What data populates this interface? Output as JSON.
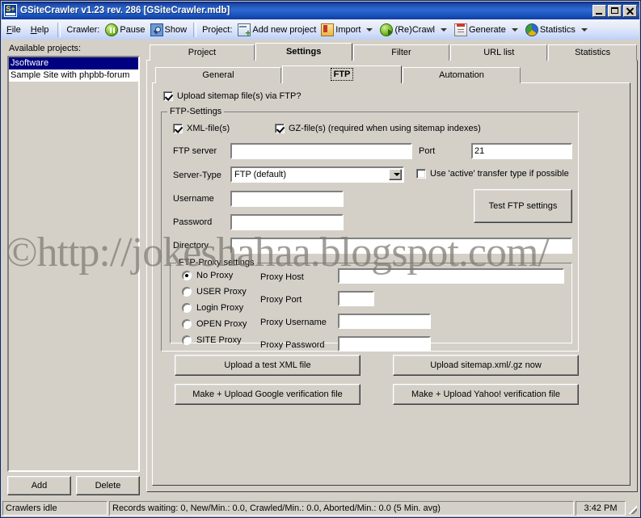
{
  "window": {
    "title": "GSiteCrawler v1.23 rev. 286 [GSiteCrawler.mdb]",
    "icon_label": "S+",
    "buttons": {
      "minimize": "minimize-icon",
      "maximize": "maximize-icon",
      "close": "close-icon"
    }
  },
  "menu": {
    "items": [
      {
        "label": "File",
        "accel": "F"
      },
      {
        "label": "Help",
        "accel": "H"
      }
    ]
  },
  "toolbar": {
    "crawler_label": "Crawler:",
    "pause_label": "Pause",
    "pause_icon": "pause-icon",
    "show_label": "Show",
    "show_icon": "magnifier-icon",
    "project_label": "Project:",
    "add_project_label": "Add new project",
    "add_project_icon": "add-project-icon",
    "import_label": "Import",
    "import_icon": "import-folder-icon",
    "recrawl_label": "(Re)Crawl",
    "recrawl_icon": "crawl-icon",
    "generate_label": "Generate",
    "generate_icon": "generate-icon",
    "statistics_label": "Statistics",
    "statistics_icon": "statistics-pie-icon"
  },
  "sidebar": {
    "title": "Available projects:",
    "projects": [
      {
        "name": "Jsoftware",
        "selected": true
      },
      {
        "name": "Sample Site with phpbb-forum",
        "selected": false
      }
    ],
    "add_button": "Add",
    "delete_button": "Delete"
  },
  "tabs": {
    "main": [
      {
        "label": "Project",
        "active": false
      },
      {
        "label": "Settings",
        "active": true
      },
      {
        "label": "Filter",
        "active": false
      },
      {
        "label": "URL list",
        "active": false
      },
      {
        "label": "Statistics",
        "active": false
      }
    ],
    "sub": [
      {
        "label": "General",
        "active": false
      },
      {
        "label": "FTP",
        "active": true
      },
      {
        "label": "Automation",
        "active": false
      }
    ]
  },
  "ftp": {
    "upload_via_ftp": {
      "label": "Upload sitemap file(s) via FTP?",
      "checked": true
    },
    "settings_group_title": "FTP-Settings",
    "xml_files": {
      "label": "XML-file(s)",
      "checked": true
    },
    "gz_files": {
      "label": "GZ-file(s) (required when using sitemap indexes)",
      "checked": true
    },
    "server_label": "FTP server",
    "server_value": "",
    "port_label": "Port",
    "port_value": "21",
    "servertype_label": "Server-Type",
    "servertype_value": "FTP (default)",
    "active_transfer": {
      "label": "Use 'active' transfer type if possible",
      "checked": false
    },
    "username_label": "Username",
    "username_value": "",
    "password_label": "Password",
    "password_value": "",
    "directory_label": "Directory",
    "directory_value": "",
    "test_button": "Test FTP settings",
    "proxy_group_title": "FTP-Proxy settings",
    "proxy_modes": [
      {
        "label": "No Proxy",
        "selected": true
      },
      {
        "label": "USER Proxy",
        "selected": false
      },
      {
        "label": "Login Proxy",
        "selected": false
      },
      {
        "label": "OPEN Proxy",
        "selected": false
      },
      {
        "label": "SITE Proxy",
        "selected": false
      }
    ],
    "proxy_host_label": "Proxy Host",
    "proxy_host_value": "",
    "proxy_port_label": "Proxy Port",
    "proxy_port_value": "",
    "proxy_username_label": "Proxy Username",
    "proxy_username_value": "",
    "proxy_password_label": "Proxy Password",
    "proxy_password_value": "",
    "action_buttons": {
      "upload_test_xml": "Upload a test XML file",
      "upload_sitemap_now": "Upload sitemap.xml/.gz now",
      "make_upload_google": "Make + Upload Google verification file",
      "make_upload_yahoo": "Make + Upload Yahoo! verification file"
    }
  },
  "statusbar": {
    "crawler_status": "Crawlers idle",
    "records": "Records waiting: 0, New/Min.: 0.0, Crawled/Min.: 0.0, Aborted/Min.: 0.0 (5 Min. avg)",
    "time": "3:42 PM"
  },
  "watermark": {
    "text": "©http://jokeshahaa.blogspot.com/"
  },
  "colors": {
    "titlebar": "#0a246a",
    "face": "#d4d0c8",
    "selection": "#000080",
    "field": "#ffffff"
  }
}
